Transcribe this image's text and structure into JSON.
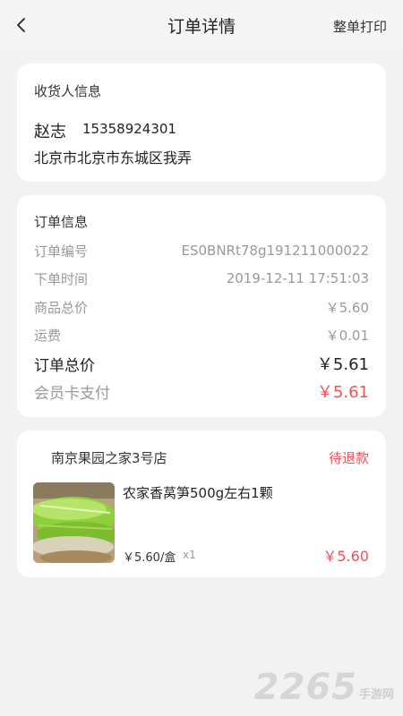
{
  "header": {
    "title": "订单详情",
    "print_label": "整单打印"
  },
  "receiver": {
    "section_title": "收货人信息",
    "name": "赵志",
    "phone": "15358924301",
    "address": "北京市北京市东城区我弄"
  },
  "order": {
    "section_title": "订单信息",
    "rows": [
      {
        "label": "订单编号",
        "value": "ES0BNRt78g191211000022"
      },
      {
        "label": "下单时间",
        "value": "2019-12-11 17:51:03"
      },
      {
        "label": "商品总价",
        "value": "￥5.60"
      },
      {
        "label": "运费",
        "value": "￥0.01"
      }
    ],
    "total_label": "订单总价",
    "total_value": "￥5.61",
    "pay_label": "会员卡支付",
    "pay_value": "￥5.61"
  },
  "shop": {
    "name": "南京果园之家3号店",
    "status": "待退款",
    "status_color": "#f0505a",
    "product": {
      "name": "农家香莴笋500g左右1颗",
      "unit_price": "￥5.60/盒",
      "quantity": "x1",
      "total": "￥5.60"
    }
  },
  "watermark": {
    "number": "2265",
    "text": "手游网"
  }
}
